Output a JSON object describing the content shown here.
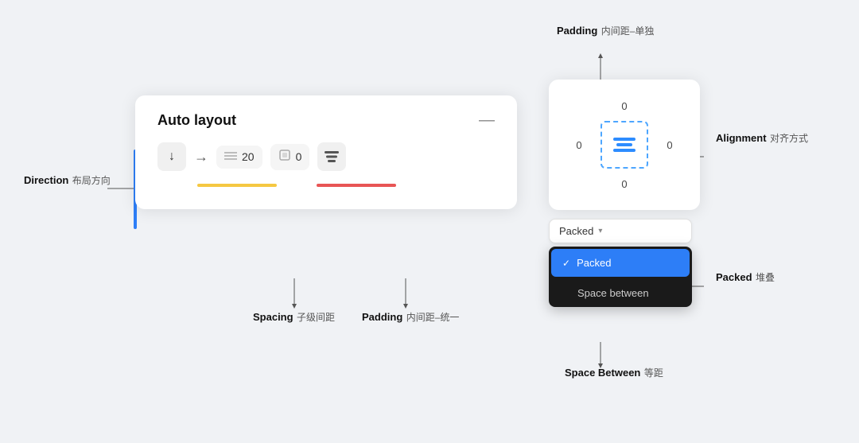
{
  "panel": {
    "title": "Auto layout",
    "minus": "—",
    "direction_down": "↓",
    "direction_right": "→",
    "spacing_value": "20",
    "padding_value": "0"
  },
  "annotations": {
    "direction": {
      "title": "Direction",
      "sub": "布局方向"
    },
    "spacing": {
      "title": "Spacing",
      "sub": "子级间距"
    },
    "padding_uni": {
      "title": "Padding",
      "sub": "内间距–统一"
    },
    "padding_single": {
      "title": "Padding",
      "sub": "内间距–单独"
    },
    "alignment": {
      "title": "Alignment",
      "sub": "对齐方式"
    },
    "packed": {
      "title": "Packed",
      "sub": "堆叠"
    },
    "space_between": {
      "title": "Space Between",
      "sub": "等距"
    }
  },
  "align_panel": {
    "top": "0",
    "left": "0",
    "right": "0",
    "bottom": "0"
  },
  "dropdown": {
    "selector_label": "Packed",
    "items": [
      {
        "label": "Packed",
        "active": true
      },
      {
        "label": "Space between",
        "active": false
      }
    ]
  }
}
